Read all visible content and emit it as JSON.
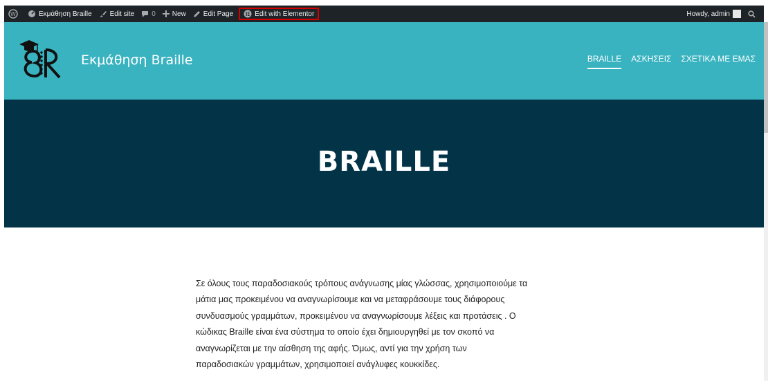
{
  "admin_bar": {
    "site_name": "Εκμάθηση Braille",
    "edit_site": "Edit site",
    "comments_count": "0",
    "new_label": "New",
    "edit_page": "Edit Page",
    "edit_elementor": "Edit with Elementor",
    "howdy": "Howdy, admin"
  },
  "header": {
    "site_title": "Εκμάθηση Braille",
    "logo_text": "BR",
    "nav": [
      {
        "label": "BRAILLE",
        "active": true
      },
      {
        "label": "ΑΣΚΗΣΕΙΣ",
        "active": false
      },
      {
        "label": "ΣΧΕΤΙΚΑ ΜΕ ΕΜΑΣ",
        "active": false
      }
    ]
  },
  "hero": {
    "title": "BRAILLE"
  },
  "content": {
    "lines": [
      "Σε όλους τους παραδοσιακούς τρόπους ανάγνωσης μίας γλώσσας, χρησιμοποιούμε τα",
      "μάτια μας προκειμένου να αναγνωρίσουμε και να μεταφράσουμε τους διάφορους",
      "συνδυασμούς γραμμάτων, προκειμένου να αναγνωρίσουμε λέξεις και προτάσεις . Ο",
      "κώδικας Braille είναι ένα σύστημα το οποίο έχει δημιουργηθεί με τον σκοπό να",
      "αναγνωρίζεται με την αίσθηση της αφής. Όμως, αντί για την χρήση των",
      "παραδοσιακών γραμμάτων, χρησιμοποιεί ανάγλυφες κουκκίδες."
    ]
  },
  "colors": {
    "admin_bar": "#1d2327",
    "header": "#3ab3c1",
    "hero": "#023346",
    "highlight": "#d40000"
  }
}
